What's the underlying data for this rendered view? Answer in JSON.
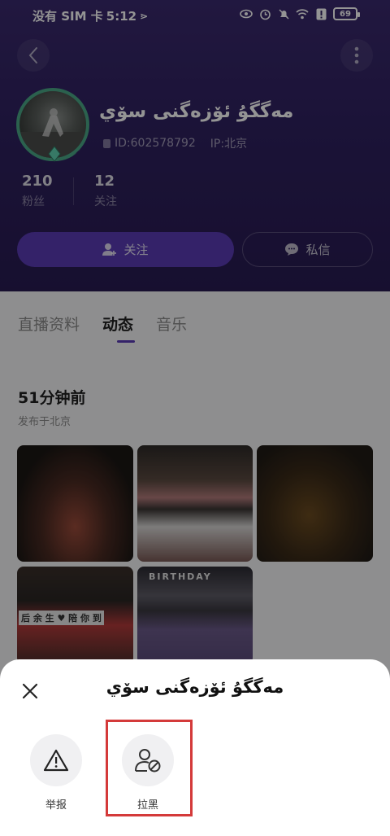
{
  "status_bar": {
    "carrier": "没有 SIM 卡",
    "time": "5:12",
    "battery": "69"
  },
  "profile": {
    "name": "مەگگۇ  ئۆزەگنى سۆي",
    "id_text": "ID:602578792",
    "ip_text": "IP:北京",
    "fans_count": "210",
    "fans_label": "粉丝",
    "follow_count": "12",
    "follow_label": "关注"
  },
  "actions": {
    "follow_label": "关注",
    "message_label": "私信"
  },
  "tabs": [
    {
      "label": "直播资料"
    },
    {
      "label": "动态"
    },
    {
      "label": "音乐"
    }
  ],
  "post": {
    "time": "51分钟前",
    "location": "发布于北京"
  },
  "photos": {
    "p4_text": "后 余 生 ♥ 陪 你 到",
    "p5_text": "BIRTHDAY"
  },
  "sheet": {
    "title": "مەگگۇ  ئۆزەگنى سۆي",
    "report_label": "举报",
    "block_label": "拉黑"
  },
  "colors": {
    "header_bg": "#2f2160",
    "accent": "#5a3bb5",
    "highlight": "#d43a3a"
  }
}
